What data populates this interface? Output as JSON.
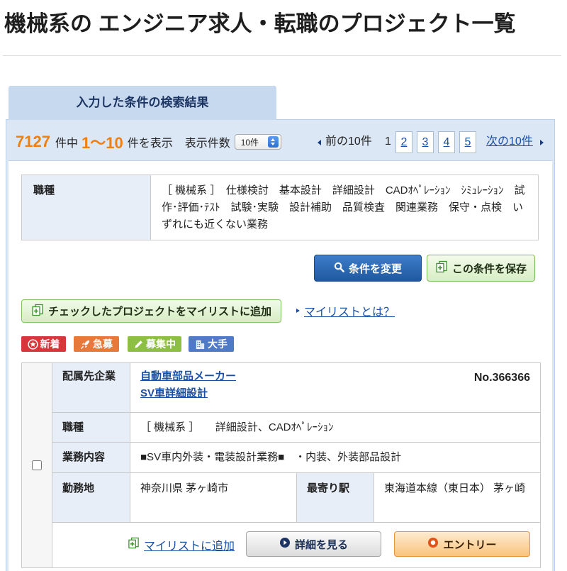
{
  "page_title": "機械系の エンジニア求人・転職のプロジェクト一覧",
  "result_tab": "入力した条件の検索結果",
  "results_bar": {
    "total_count": "7127",
    "total_suffix": "件中",
    "range": "1〜10",
    "range_suffix": "件を表示",
    "per_page_label": "表示件数",
    "per_page_selected": "10件",
    "prev_label": "前の10件",
    "current_page": "1",
    "page_links": [
      "2",
      "3",
      "4",
      "5"
    ],
    "next_label": "次の10件"
  },
  "search_conditions": {
    "label": "職種",
    "value": "［ 機械系 ］　仕様検討　基本設計　詳細設計　CADｵﾍﾟﾚｰｼｮﾝ　ｼﾐｭﾚｰｼｮﾝ　試作･評価･ﾃｽﾄ　試験･実験　設計補助　品質検査　関連業務　保守・点検　いずれにも近くない業務"
  },
  "actions": {
    "change_conditions": "条件を変更",
    "save_conditions": "この条件を保存",
    "add_checked_to_mylist": "チェックしたプロジェクトをマイリストに追加",
    "what_is_mylist": "マイリストとは？"
  },
  "badge_legend": [
    {
      "label": "新着",
      "icon": "star-circle-icon",
      "color": "#d9363b"
    },
    {
      "label": "急募",
      "icon": "rocket-icon",
      "color": "#e7793a"
    },
    {
      "label": "募集中",
      "icon": "pencil-icon",
      "color": "#8cbf44"
    },
    {
      "label": "大手",
      "icon": "building-icon",
      "color": "#4f7bc6"
    }
  ],
  "job": {
    "company_label": "配属先企業",
    "company_name": "自動車部品メーカー",
    "project_title": "SV車詳細設計",
    "number": "No.366366",
    "job_type_label": "職種",
    "job_type_value": "［ 機械系 ］　　詳細設計、CADｵﾍﾟﾚｰｼｮﾝ",
    "duties_label": "業務内容",
    "duties_value": "■SV車内外装・電装設計業務■　・内装、外装部品設計",
    "location_label": "勤務地",
    "location_value": "神奈川県 茅ヶ崎市",
    "station_label": "最寄り駅",
    "station_value": "東海道本線（東日本） 茅ヶ崎",
    "add_to_mylist": "マイリストに追加",
    "details_button": "詳細を見る",
    "entry_button": "エントリー"
  },
  "colors": {
    "count_highlight": "#ee7f10",
    "link": "#1a4fa6",
    "primary_button": "#2a66b2",
    "label_background": "#e7eef8",
    "tab_background": "#c7d9ef"
  }
}
